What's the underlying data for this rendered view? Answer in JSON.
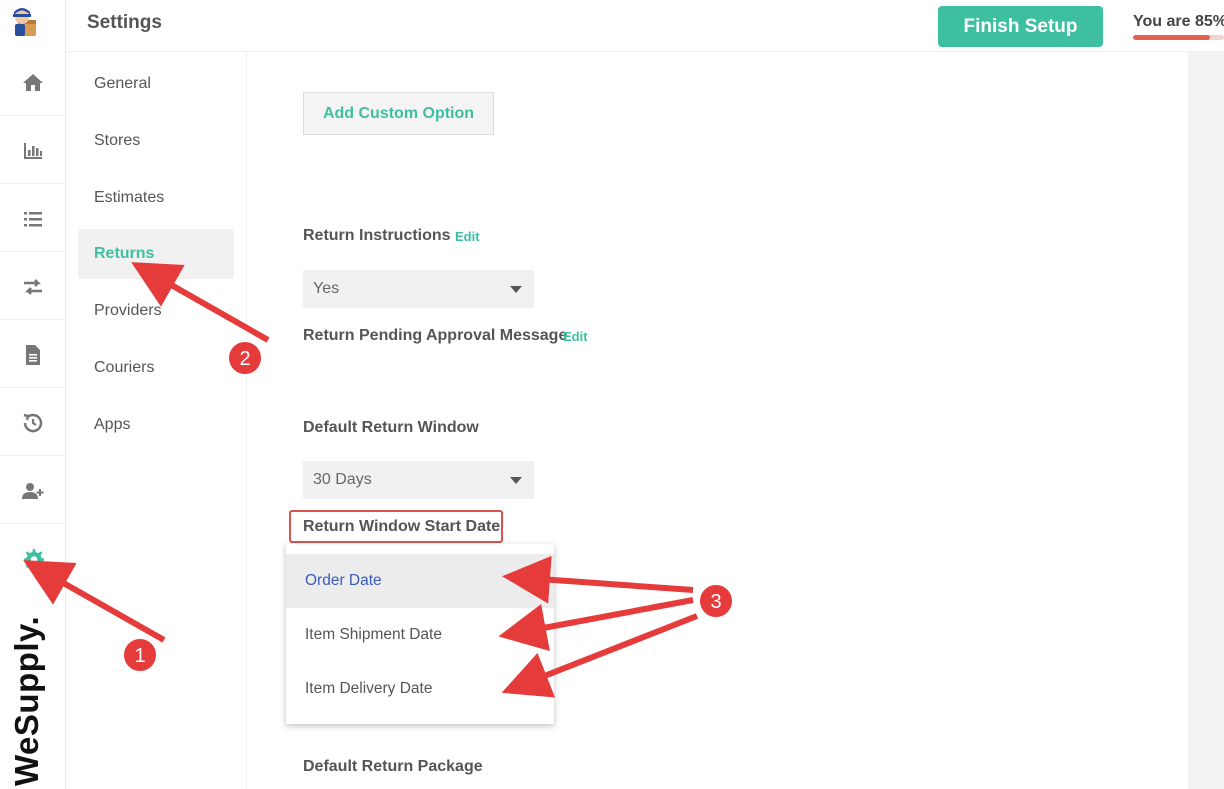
{
  "header": {
    "title": "Settings",
    "finish_button": "Finish Setup",
    "progress_text": "You are 85%",
    "progress_value": 0.85
  },
  "rail": {
    "brand": "WeSupply.",
    "icons": [
      "home-icon",
      "analytics-icon",
      "list-icon",
      "transfer-icon",
      "document-icon",
      "history-icon",
      "add-user-icon",
      "settings-gear-icon"
    ]
  },
  "subnav": {
    "items": [
      "General",
      "Stores",
      "Estimates",
      "Returns",
      "Providers",
      "Couriers",
      "Apps"
    ],
    "active": "Returns"
  },
  "main": {
    "add_custom_option": "Add Custom Option",
    "return_instructions_label": "Return Instructions",
    "return_instructions_edit": "Edit",
    "return_instructions_value": "Yes",
    "pending_message_label": "Return Pending Approval Message",
    "pending_message_edit": "Edit",
    "default_window_label": "Default Return Window",
    "default_window_value": "30 Days",
    "start_date_label": "Return Window Start Date",
    "start_date_options": [
      "Order Date",
      "Item Shipment Date",
      "Item Delivery Date"
    ],
    "start_date_selected": "Order Date",
    "default_package_label": "Default Return Package"
  },
  "annotations": {
    "marker_1": "1",
    "marker_2": "2",
    "marker_3": "3",
    "accent_color": "#e53b3b"
  },
  "colors": {
    "brand_green": "#3dbfa0",
    "progress_red": "#e2604f",
    "selected_blue": "#3c5bb5"
  }
}
